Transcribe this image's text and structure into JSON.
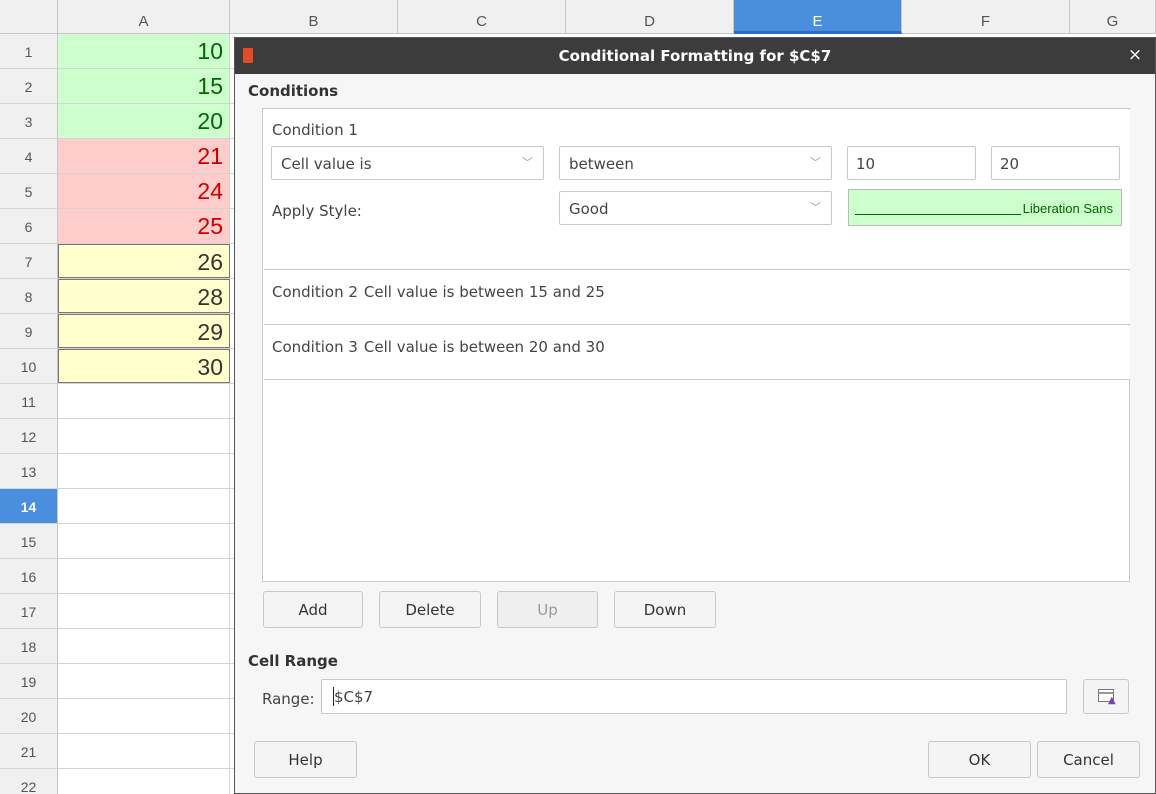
{
  "sheet": {
    "columns": [
      "A",
      "B",
      "C",
      "D",
      "E",
      "F",
      "G"
    ],
    "selected_column": "E",
    "rows": [
      "1",
      "2",
      "3",
      "4",
      "5",
      "6",
      "7",
      "8",
      "9",
      "10",
      "11",
      "12",
      "13",
      "14",
      "15",
      "16",
      "17",
      "18",
      "19",
      "20",
      "21",
      "22"
    ],
    "selected_row": "14",
    "cells_a": [
      {
        "value": "10",
        "style": "green"
      },
      {
        "value": "15",
        "style": "green"
      },
      {
        "value": "20",
        "style": "green"
      },
      {
        "value": "21",
        "style": "red"
      },
      {
        "value": "24",
        "style": "red"
      },
      {
        "value": "25",
        "style": "red"
      },
      {
        "value": "26",
        "style": "yellow"
      },
      {
        "value": "28",
        "style": "yellow"
      },
      {
        "value": "29",
        "style": "yellow"
      },
      {
        "value": "30",
        "style": "yellow"
      }
    ],
    "colors": {
      "good_bg": "#ccffcc",
      "good_fg": "#006600",
      "bad_bg": "#ffcccc",
      "bad_fg": "#cc0000",
      "neutral_bg": "#ffffcc",
      "selection": "#4a8fdd"
    }
  },
  "dialog": {
    "title": "Conditional Formatting for $C$7",
    "close_glyph": "×",
    "conditions_heading": "Conditions",
    "condition1": {
      "label": "Condition 1",
      "type": "Cell value is",
      "operator": "between",
      "value1": "10",
      "value2": "20",
      "apply_style_label": "Apply Style:",
      "style": "Good",
      "preview_text": "Liberation Sans"
    },
    "condition2": {
      "label": "Condition 2",
      "description": "Cell value is between 15 and 25"
    },
    "condition3": {
      "label": "Condition 3",
      "description": "Cell value is between 20 and 30"
    },
    "buttons": {
      "add": "Add",
      "delete": "Delete",
      "up": "Up",
      "down": "Down"
    },
    "cell_range_heading": "Cell Range",
    "range_label": "Range:",
    "range_value": "$C$7",
    "help": "Help",
    "ok": "OK",
    "cancel": "Cancel",
    "icons": {
      "app": "office-logo-icon",
      "close": "close-icon",
      "chevron": "chevron-down-icon",
      "shrink": "shrink-range-icon"
    }
  }
}
